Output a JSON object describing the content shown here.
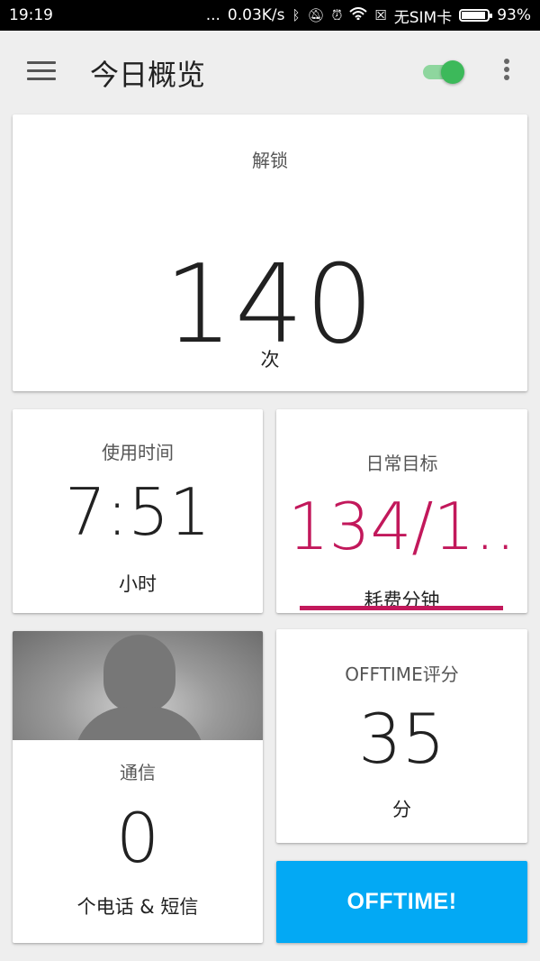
{
  "status_bar": {
    "time": "19:19",
    "dots": "...",
    "speed": "0.03K/s",
    "sim": "无SIM卡",
    "battery": "93%"
  },
  "app_bar": {
    "title": "今日概览",
    "menu_icon": "hamburger-menu-icon",
    "toggle_on": true,
    "more_icon": "more-vert-icon"
  },
  "unlock": {
    "label": "解锁",
    "value": "140",
    "unit": "次"
  },
  "usage": {
    "label": "使用时间",
    "value": "7:51",
    "unit": "小时"
  },
  "goal": {
    "label": "日常目标",
    "value": "134/1..",
    "unit": "耗费分钟",
    "accent": "#c2185b"
  },
  "communication": {
    "label": "通信",
    "value": "0",
    "unit": "个电话 & 短信",
    "avatar_icon": "contact-avatar-icon"
  },
  "score": {
    "label": "OFFTIME评分",
    "value": "35",
    "unit": "分"
  },
  "offtime_button": {
    "label": "OFFTIME!",
    "color": "#03a9f4"
  }
}
